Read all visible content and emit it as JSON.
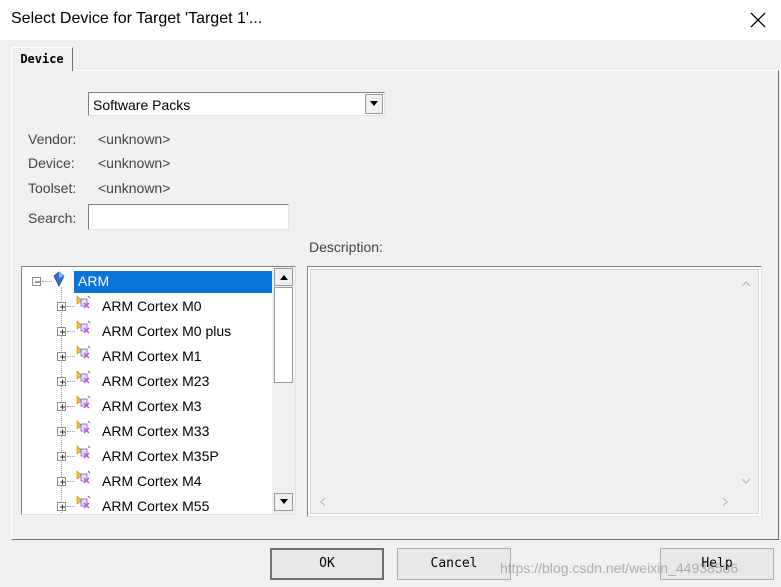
{
  "window": {
    "title": "Select Device for Target 'Target 1'..."
  },
  "tab": {
    "label": "Device"
  },
  "source_select": {
    "value": "Software Packs"
  },
  "fields": {
    "vendor_label": "Vendor:",
    "vendor_value": "<unknown>",
    "device_label": "Device:",
    "device_value": "<unknown>",
    "toolset_label": "Toolset:",
    "toolset_value": "<unknown>",
    "search_label": "Search:",
    "search_value": ""
  },
  "description": {
    "label": "Description:"
  },
  "tree": {
    "root": {
      "label": "ARM",
      "expanded": true,
      "selected": true
    },
    "items": [
      {
        "label": "ARM Cortex M0"
      },
      {
        "label": "ARM Cortex M0 plus"
      },
      {
        "label": "ARM Cortex M1"
      },
      {
        "label": "ARM Cortex M23"
      },
      {
        "label": "ARM Cortex M3"
      },
      {
        "label": "ARM Cortex M33"
      },
      {
        "label": "ARM Cortex M35P"
      },
      {
        "label": "ARM Cortex M4"
      },
      {
        "label": "ARM Cortex M55"
      }
    ]
  },
  "buttons": {
    "ok": "OK",
    "cancel": "Cancel",
    "help": "Help"
  },
  "watermark": "https://blog.csdn.net/weixin_44938586",
  "colors": {
    "selection": "#0a74da",
    "dialog_bg": "#f0f0f0"
  }
}
